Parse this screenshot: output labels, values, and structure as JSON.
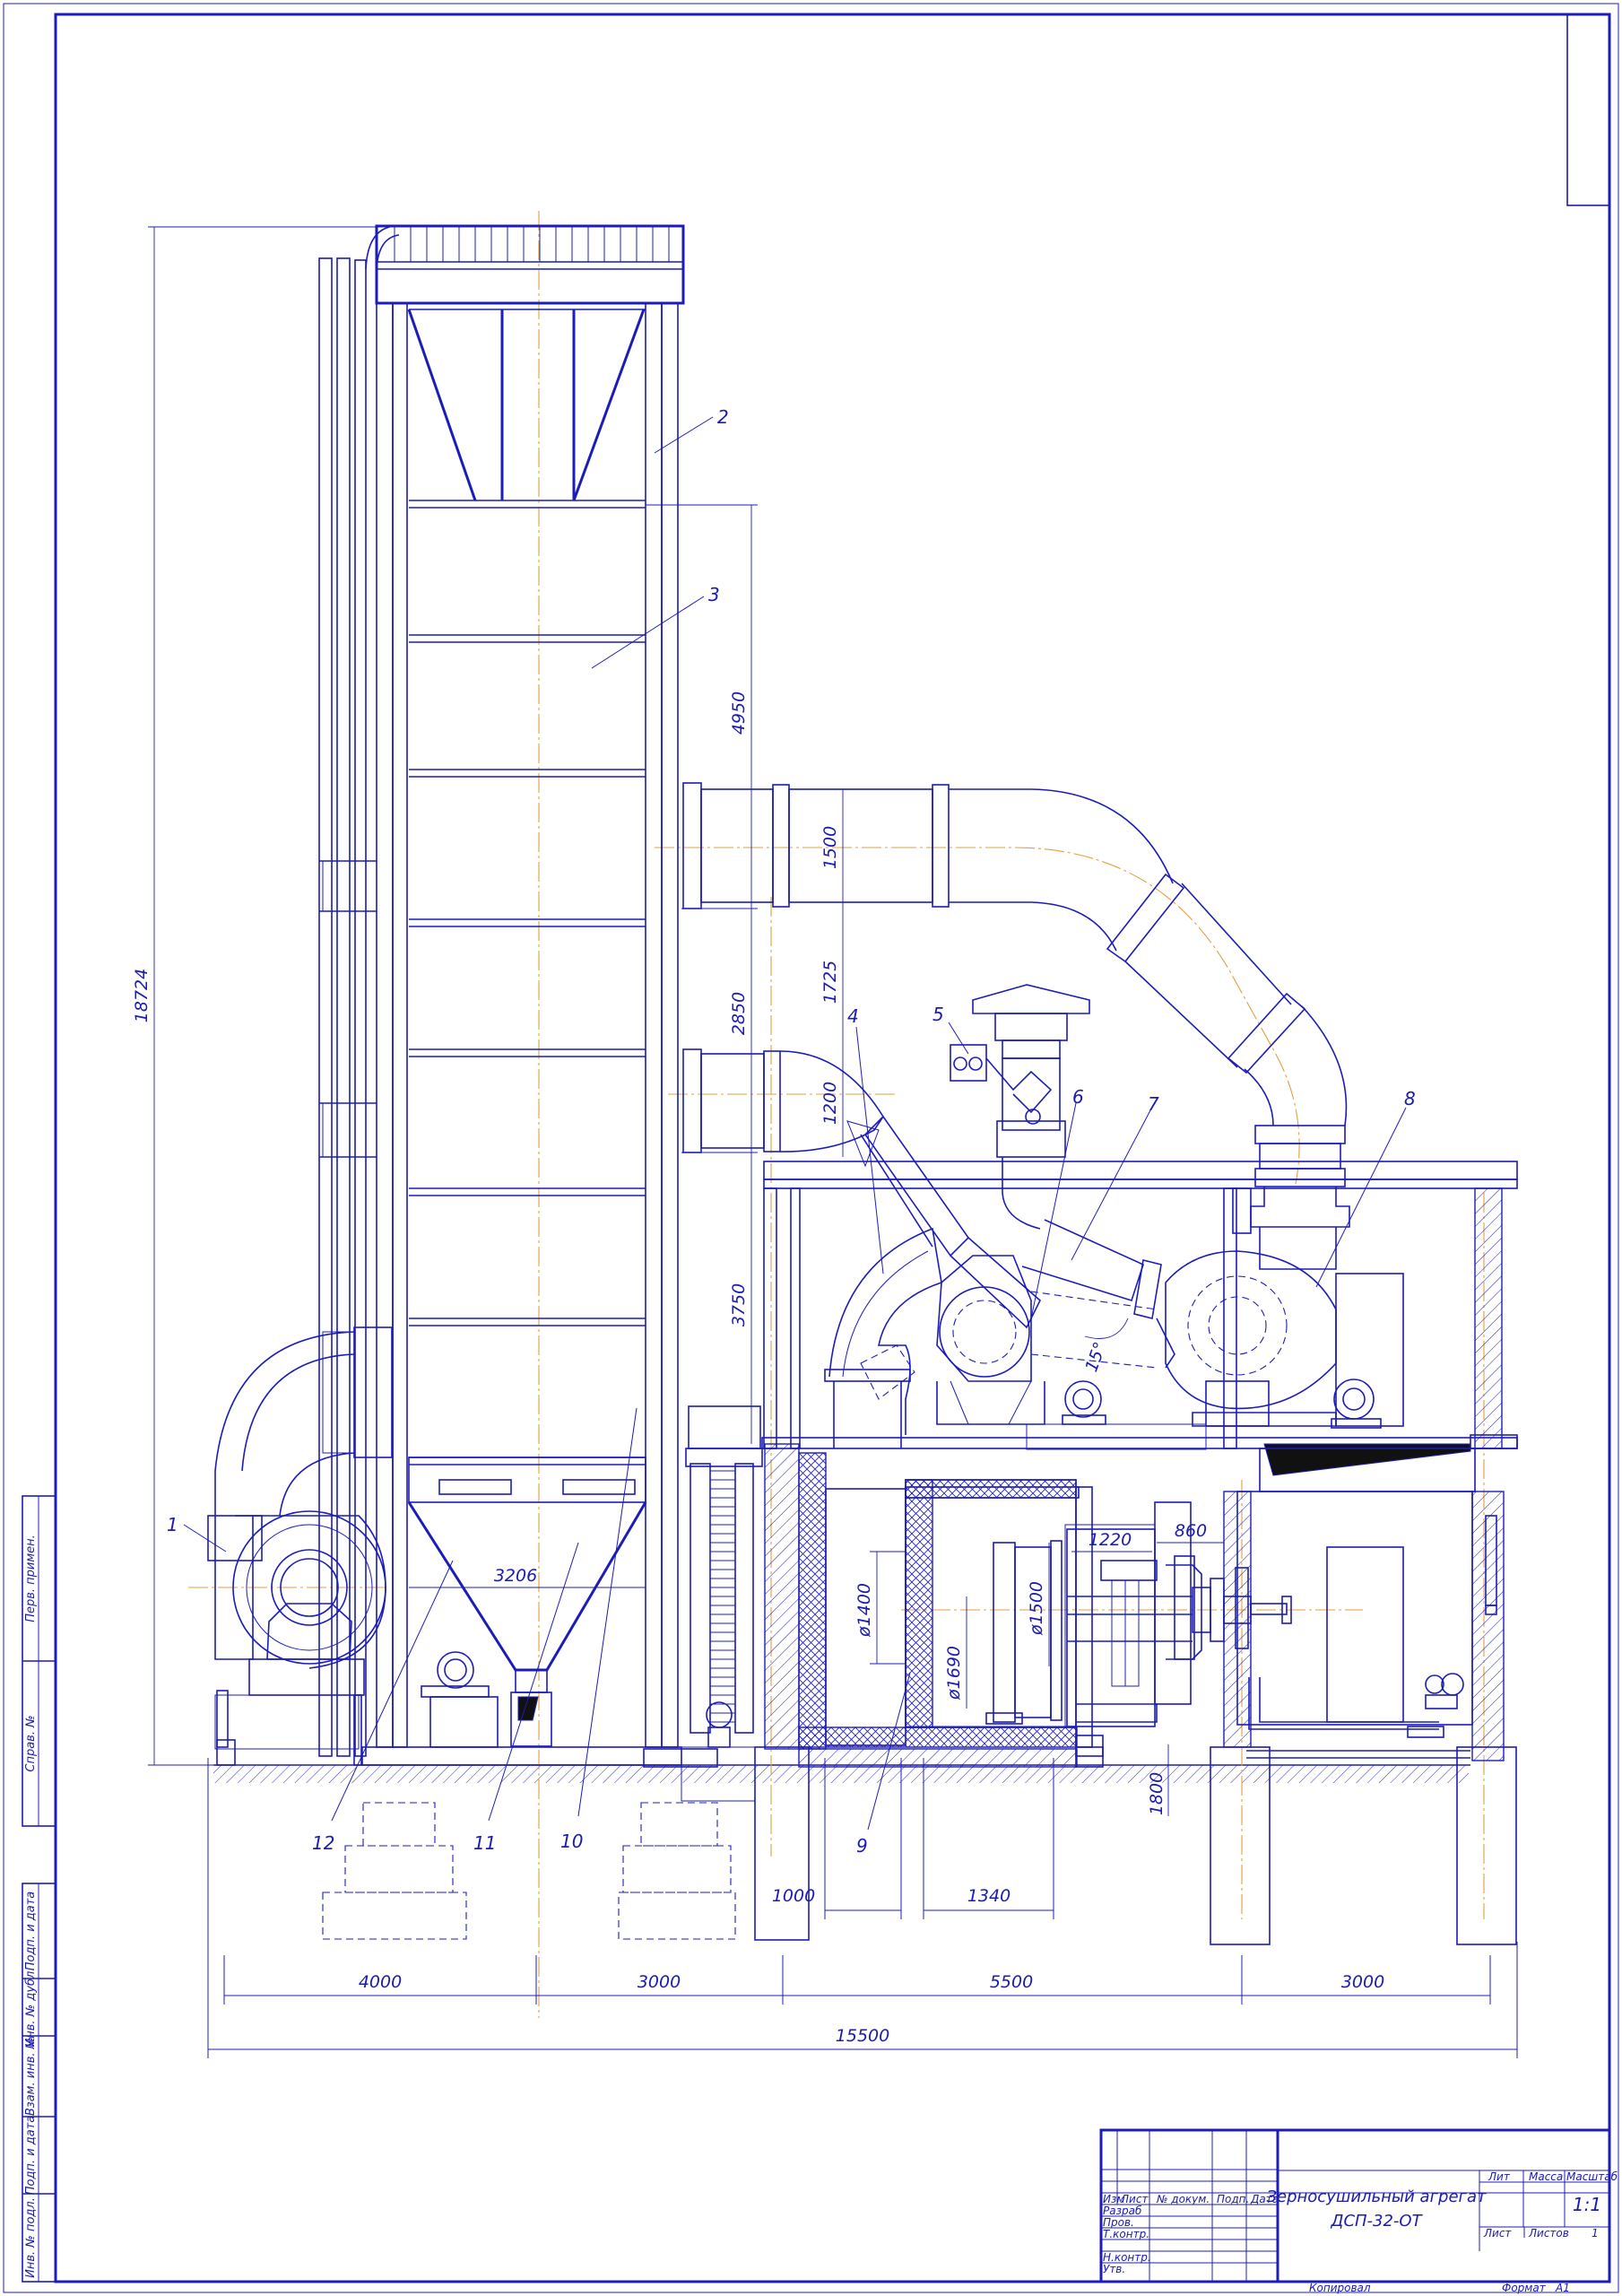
{
  "title_block": {
    "title_line1": "Зерносушильный агрегат",
    "title_line2": "ДСП-32-ОТ",
    "col_headers": [
      "Изм",
      "Лист",
      "№ докум.",
      "Подп.",
      "Дата"
    ],
    "row_labels": [
      "Разраб",
      "Пров.",
      "Т.контр.",
      "Н.контр.",
      "Утв."
    ],
    "lit_label": "Лит",
    "mass_label": "Масса",
    "scale_label": "Масштаб",
    "scale_value": "1:1",
    "sheet_label": "Лист",
    "sheets_label": "Листов",
    "sheets_value": "1",
    "copied_label": "Копировал",
    "format_label": "Формат",
    "format_value": "A1"
  },
  "side_stamps": [
    "Перв. примен.",
    "Справ. №",
    "Подп. и дата",
    "Инв. № дубл.",
    "Взам. инв. №",
    "Подп. и дата",
    "Инв. № подл."
  ],
  "part_labels": [
    "1",
    "2",
    "3",
    "4",
    "5",
    "6",
    "7",
    "8",
    "9",
    "10",
    "11",
    "12"
  ],
  "dimensions": {
    "overall_height": "18724",
    "tower_upper": "4950",
    "tower_mid": "2850",
    "tower_lower": "3750",
    "duct_upper": "1500",
    "duct_gap": "1725",
    "duct_lower": "1200",
    "hopper_width": "3206",
    "d_inner": "ø1400",
    "d_furnace1": "ø1500",
    "d_furnace2": "ø1690",
    "width_1220": "1220",
    "width_860": "860",
    "depth_1800": "1800",
    "foot_1000": "1000",
    "foot_1340": "1340",
    "angle": "15°",
    "span_4000": "4000",
    "span_3000a": "3000",
    "span_5500": "5500",
    "span_3000b": "3000",
    "overall_length": "15500"
  }
}
